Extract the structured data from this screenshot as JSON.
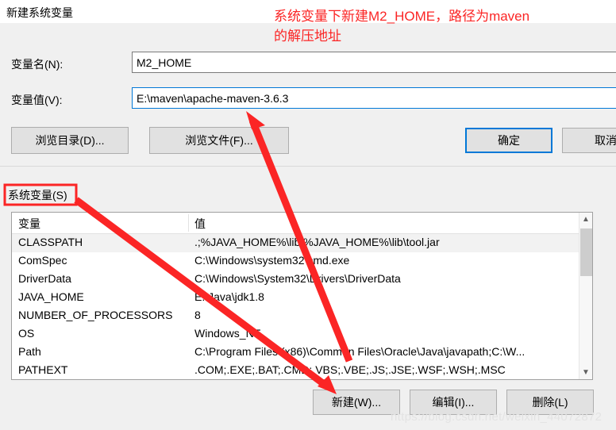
{
  "dialog": {
    "title": "新建系统变量",
    "fields": {
      "name_label": "变量名(N):",
      "name_value": "M2_HOME",
      "value_label": "变量值(V):",
      "value_value": "E:\\maven\\apache-maven-3.6.3"
    },
    "buttons": {
      "browse_dir": "浏览目录(D)...",
      "browse_file": "浏览文件(F)...",
      "ok": "确定",
      "cancel": "取消"
    },
    "focus_color": "#0078d7"
  },
  "env_window": {
    "group_label": "系统变量(S)",
    "columns": [
      "变量",
      "值"
    ],
    "rows": [
      {
        "name": "CLASSPATH",
        "value": ".;%JAVA_HOME%\\lib;%JAVA_HOME%\\lib\\tool.jar",
        "selected": true
      },
      {
        "name": "ComSpec",
        "value": "C:\\Windows\\system32\\cmd.exe",
        "selected": false
      },
      {
        "name": "DriverData",
        "value": "C:\\Windows\\System32\\Drivers\\DriverData",
        "selected": false
      },
      {
        "name": "JAVA_HOME",
        "value": "E:\\Java\\jdk1.8",
        "selected": false
      },
      {
        "name": "NUMBER_OF_PROCESSORS",
        "value": "8",
        "selected": false
      },
      {
        "name": "OS",
        "value": "Windows_NT",
        "selected": false
      },
      {
        "name": "Path",
        "value": "C:\\Program Files (x86)\\Common Files\\Oracle\\Java\\javapath;C:\\W...",
        "selected": false
      },
      {
        "name": "PATHEXT",
        "value": ".COM;.EXE;.BAT;.CMD;.VBS;.VBE;.JS;.JSE;.WSF;.WSH;.MSC",
        "selected": false
      }
    ],
    "scrollbar": {
      "up_icon": "chevron-up",
      "down_icon": "chevron-down"
    },
    "buttons": {
      "new": "新建(W)...",
      "edit": "编辑(I)...",
      "delete": "删除(L)"
    }
  },
  "annotation": {
    "text": "系统变量下新建M2_HOME，路径为maven\n的解压地址",
    "color": "#fb2525"
  },
  "watermark": {
    "text": "https://blog.csdn.net/weixin_44072872"
  }
}
